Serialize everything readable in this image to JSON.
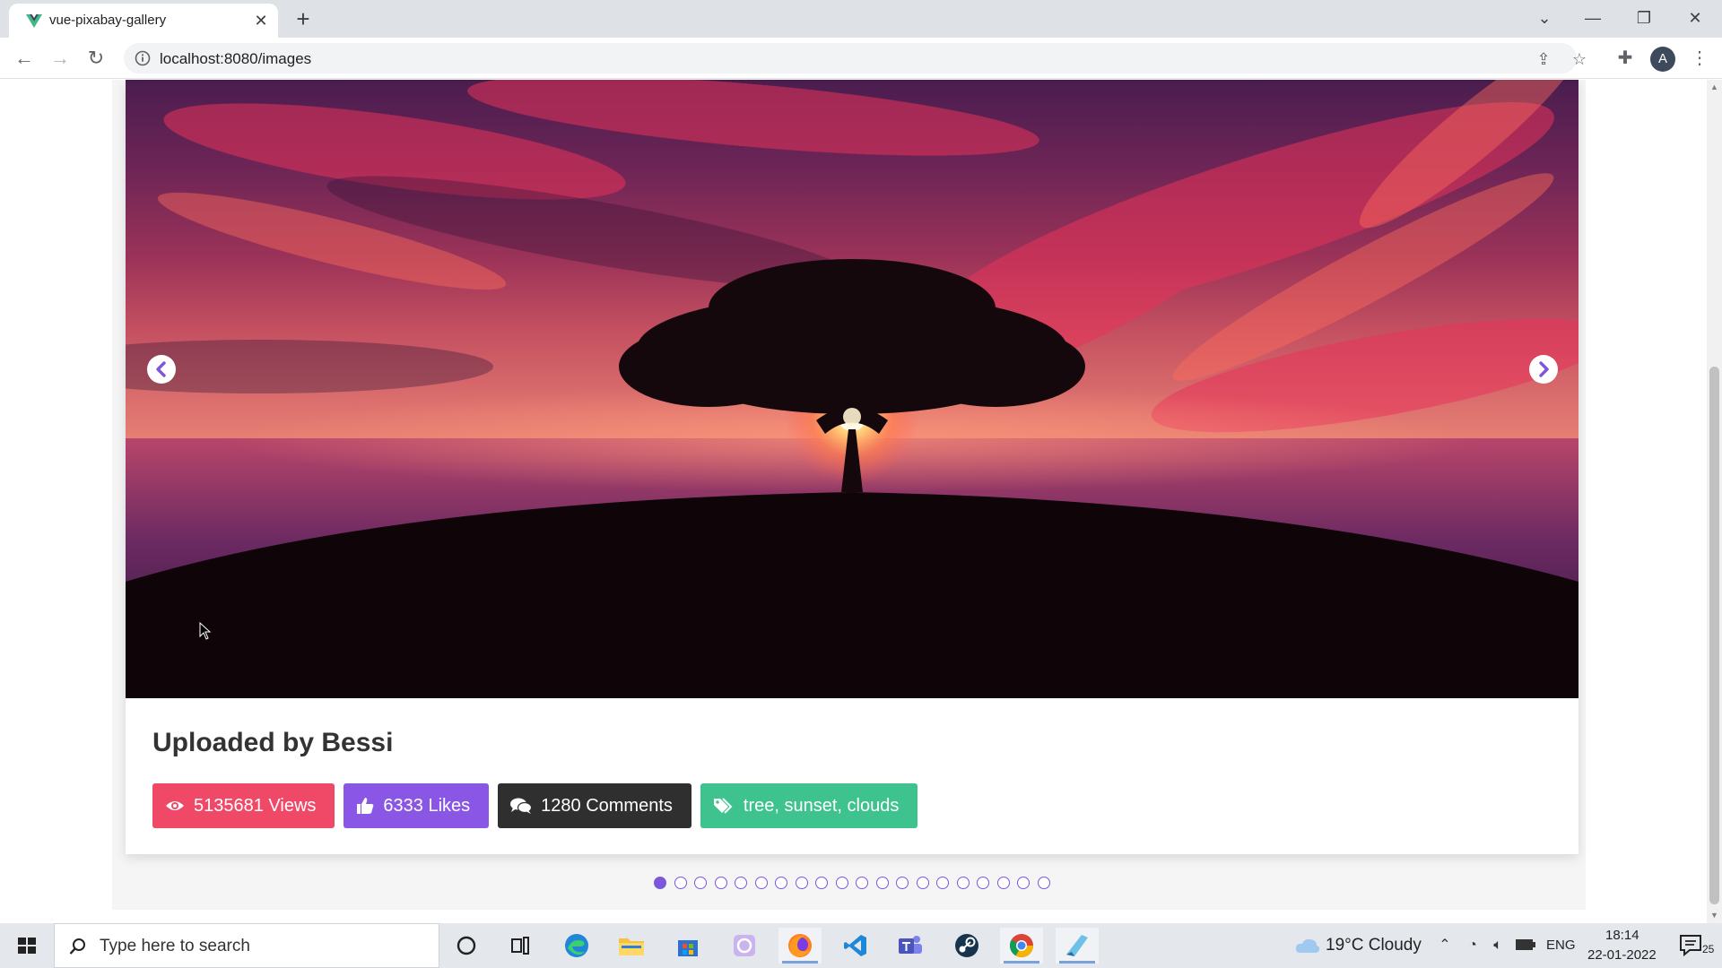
{
  "browser": {
    "tab_title": "vue-pixabay-gallery",
    "tab_close": "✕",
    "new_tab": "+",
    "url": "localhost:8080/images",
    "profile_initial": "A",
    "window_controls": {
      "dropdown": "⌄",
      "minimize": "—",
      "restore": "❐",
      "close": "✕"
    }
  },
  "post": {
    "uploader_label": "Uploaded by Bessi",
    "views_label": "5135681 Views",
    "likes_label": "6333 Likes",
    "comments_label": "1280 Comments",
    "tags_label": "tree, sunset, clouds",
    "image_subject": "tree silhouette at sunset over sea with red clouds"
  },
  "carousel": {
    "slide_count": 20,
    "active_index": 0
  },
  "taskbar": {
    "search_placeholder": "Type here to search",
    "apps": [
      "cortana",
      "task-view",
      "edge",
      "file-explorer",
      "store",
      "app-icon",
      "firefox",
      "vscode",
      "teams",
      "steam",
      "chrome",
      "app-icon-2"
    ],
    "weather": "19°C  Cloudy",
    "language": "ENG",
    "time": "18:14",
    "date": "22-01-2022",
    "notification_count": "25"
  },
  "colors": {
    "views": "#f04867",
    "likes": "#8a56e6",
    "comments": "#2f2f2f",
    "tags": "#3ec38e",
    "carousel_accent": "#7d57db"
  }
}
